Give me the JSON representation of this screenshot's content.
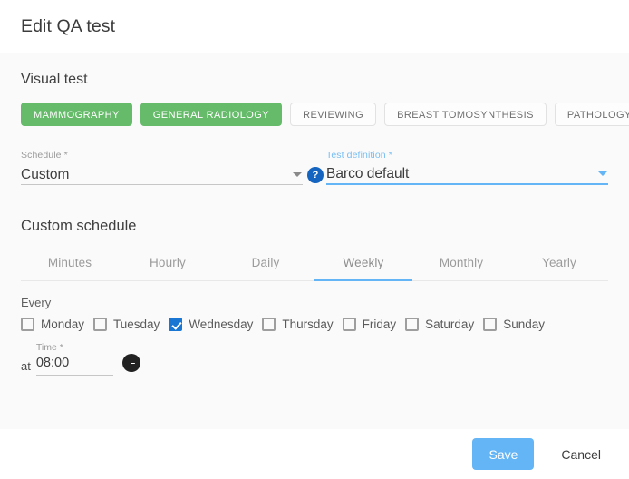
{
  "header": {
    "title": "Edit QA test"
  },
  "visual_test": {
    "section_title": "Visual test",
    "chips": [
      {
        "label": "MAMMOGRAPHY",
        "selected": true
      },
      {
        "label": "GENERAL RADIOLOGY",
        "selected": true
      },
      {
        "label": "REVIEWING",
        "selected": false
      },
      {
        "label": "BREAST TOMOSYNTHESIS",
        "selected": false
      },
      {
        "label": "PATHOLOGY",
        "selected": false
      }
    ],
    "schedule_field": {
      "label": "Schedule *",
      "value": "Custom",
      "help_icon": "help-question-icon",
      "caret_icon": "chevron-down-icon"
    },
    "test_definition_field": {
      "label": "Test definition *",
      "value": "Barco default",
      "caret_icon": "chevron-down-icon",
      "focused": true
    }
  },
  "custom_schedule": {
    "section_title": "Custom schedule",
    "tabs": [
      {
        "label": "Minutes",
        "active": false
      },
      {
        "label": "Hourly",
        "active": false
      },
      {
        "label": "Daily",
        "active": false
      },
      {
        "label": "Weekly",
        "active": true
      },
      {
        "label": "Monthly",
        "active": false
      },
      {
        "label": "Yearly",
        "active": false
      }
    ],
    "every_label": "Every",
    "days": [
      {
        "label": "Monday",
        "checked": false
      },
      {
        "label": "Tuesday",
        "checked": false
      },
      {
        "label": "Wednesday",
        "checked": true
      },
      {
        "label": "Thursday",
        "checked": false
      },
      {
        "label": "Friday",
        "checked": false
      },
      {
        "label": "Saturday",
        "checked": false
      },
      {
        "label": "Sunday",
        "checked": false
      }
    ],
    "time": {
      "at_text": "at",
      "label": "Time *",
      "value": "08:00",
      "clock_icon": "clock-icon"
    }
  },
  "footer": {
    "save_label": "Save",
    "cancel_label": "Cancel"
  },
  "colors": {
    "chip_selected": "#66bb6a",
    "accent_blue": "#64b5f6",
    "checkbox_checked": "#1976d2",
    "help_blue": "#1565c0",
    "card_bg": "#fafafa"
  }
}
